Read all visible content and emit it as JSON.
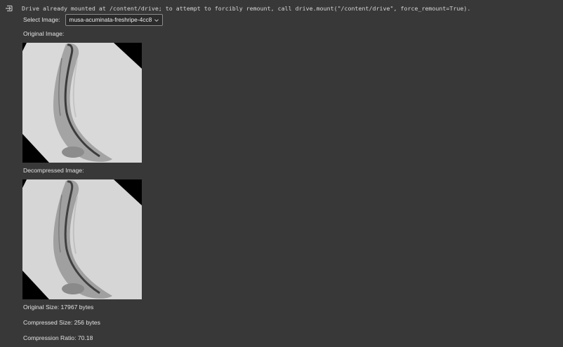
{
  "output": {
    "drive_message": "Drive already mounted at /content/drive; to attempt to forcibly remount, call drive.mount(\"/content/drive\", force_remount=True)."
  },
  "selector": {
    "label": "Select Image:",
    "value": "musa-acuminata-freshripe-4cc8"
  },
  "images": {
    "original_label": "Original Image:",
    "decompressed_label": "Decompressed Image:"
  },
  "stats": {
    "original_size": "Original Size: 17967 bytes",
    "compressed_size": "Compressed Size: 256 bytes",
    "compression_ratio": "Compression Ratio: 70.18"
  },
  "colors": {
    "background": "#383838",
    "text": "#e2e2e2"
  },
  "icons": {
    "output": "output-arrow-icon",
    "dropdown": "chevron-down-icon"
  }
}
